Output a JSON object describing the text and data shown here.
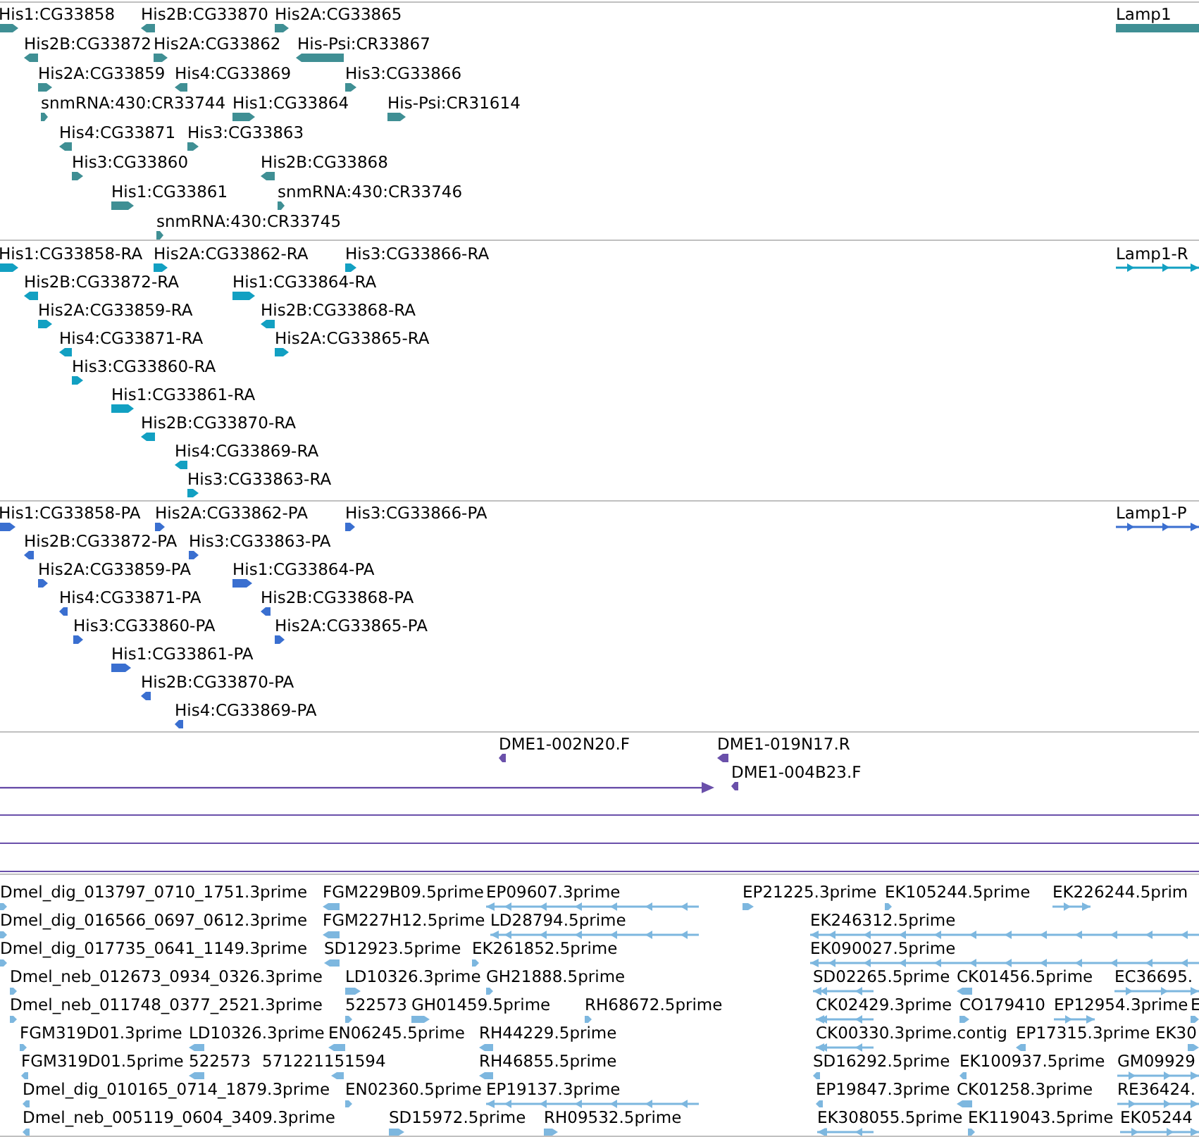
{
  "tracks": [
    {
      "kind": "gene",
      "color": "#3f8f94",
      "features": [
        {
          "label": "His1:CG33858",
          "reverse": false
        },
        {
          "label": "His2B:CG33870",
          "reverse": true
        },
        {
          "label": "His2A:CG33865",
          "reverse": false
        },
        {
          "label": "His2B:CG33872",
          "reverse": true
        },
        {
          "label": "His2A:CG33862",
          "reverse": false
        },
        {
          "label": "His-Psi:CR33867",
          "reverse": true
        },
        {
          "label": "His2A:CG33859",
          "reverse": false
        },
        {
          "label": "His4:CG33869",
          "reverse": true
        },
        {
          "label": "His3:CG33866",
          "reverse": false
        },
        {
          "label": "snmRNA:430:CR33744",
          "reverse": false
        },
        {
          "label": "His1:CG33864",
          "reverse": false
        },
        {
          "label": "His-Psi:CR31614",
          "reverse": false
        },
        {
          "label": "His4:CG33871",
          "reverse": true
        },
        {
          "label": "His3:CG33863",
          "reverse": false
        },
        {
          "label": "His3:CG33860",
          "reverse": false
        },
        {
          "label": "His2B:CG33868",
          "reverse": true
        },
        {
          "label": "His1:CG33861",
          "reverse": false
        },
        {
          "label": "snmRNA:430:CR33746",
          "reverse": false
        },
        {
          "label": "snmRNA:430:CR33745",
          "reverse": false
        },
        {
          "label": "Lamp1"
        }
      ]
    },
    {
      "kind": "transcript",
      "color": "#12a0c2",
      "features": [
        {
          "label": "His1:CG33858-RA",
          "reverse": false
        },
        {
          "label": "His2A:CG33862-RA",
          "reverse": false
        },
        {
          "label": "His3:CG33866-RA",
          "reverse": false
        },
        {
          "label": "His2B:CG33872-RA",
          "reverse": true
        },
        {
          "label": "His1:CG33864-RA",
          "reverse": false
        },
        {
          "label": "His2A:CG33859-RA",
          "reverse": false
        },
        {
          "label": "His2B:CG33868-RA",
          "reverse": true
        },
        {
          "label": "His4:CG33871-RA",
          "reverse": true
        },
        {
          "label": "His2A:CG33865-RA",
          "reverse": false
        },
        {
          "label": "His3:CG33860-RA",
          "reverse": false
        },
        {
          "label": "His1:CG33861-RA",
          "reverse": false
        },
        {
          "label": "His2B:CG33870-RA",
          "reverse": true
        },
        {
          "label": "His4:CG33869-RA",
          "reverse": true
        },
        {
          "label": "His3:CG33863-RA",
          "reverse": false
        },
        {
          "label": "Lamp1-R",
          "reverse": false
        }
      ]
    },
    {
      "kind": "protein",
      "color": "#3a6fd0",
      "features": [
        {
          "label": "His1:CG33858-PA",
          "reverse": false
        },
        {
          "label": "His2A:CG33862-PA",
          "reverse": false
        },
        {
          "label": "His3:CG33866-PA",
          "reverse": false
        },
        {
          "label": "His2B:CG33872-PA",
          "reverse": true
        },
        {
          "label": "His3:CG33863-PA",
          "reverse": false
        },
        {
          "label": "His2A:CG33859-PA",
          "reverse": false
        },
        {
          "label": "His1:CG33864-PA",
          "reverse": false
        },
        {
          "label": "His4:CG33871-PA",
          "reverse": true
        },
        {
          "label": "His2B:CG33868-PA",
          "reverse": true
        },
        {
          "label": "His3:CG33860-PA",
          "reverse": false
        },
        {
          "label": "His2A:CG33865-PA",
          "reverse": false
        },
        {
          "label": "His1:CG33861-PA",
          "reverse": false
        },
        {
          "label": "His2B:CG33870-PA",
          "reverse": true
        },
        {
          "label": "His4:CG33869-PA",
          "reverse": true
        },
        {
          "label": "Lamp1-P",
          "reverse": false
        }
      ]
    },
    {
      "kind": "clone",
      "color": "#6a50aa",
      "features": [
        {
          "label": "DME1-002N20.F",
          "reverse": true
        },
        {
          "label": "DME1-019N17.R",
          "reverse": true
        },
        {
          "label": "DME1-004B23.F",
          "reverse": true
        }
      ]
    },
    {
      "kind": "est",
      "color": "#7db7df",
      "features": [
        {
          "label": "Dmel_dig_013797_0710_1751.3prime",
          "reverse": false
        },
        {
          "label": "FGM229B09.5prime",
          "reverse": true
        },
        {
          "label": "EP09607.3prime",
          "reverse": true
        },
        {
          "label": "EP21225.3prime",
          "reverse": false
        },
        {
          "label": "EK105244.5prime",
          "reverse": false
        },
        {
          "label": "EK226244.5prim",
          "reverse": false
        },
        {
          "label": "Dmel_dig_016566_0697_0612.3prime",
          "reverse": false
        },
        {
          "label": "FGM227H12.5prime",
          "reverse": true
        },
        {
          "label": "LD28794.5prime",
          "reverse": true
        },
        {
          "label": "EK246312.5prime",
          "reverse": true
        },
        {
          "label": "Dmel_dig_017735_0641_1149.3prime",
          "reverse": false
        },
        {
          "label": "SD12923.5prime",
          "reverse": true
        },
        {
          "label": "EK261852.5prime",
          "reverse": false
        },
        {
          "label": "EK090027.5prime",
          "reverse": true
        },
        {
          "label": "Dmel_neb_012673_0934_0326.3prime",
          "reverse": false
        },
        {
          "label": "LD10326.3prime",
          "reverse": false
        },
        {
          "label": "GH21888.5prime",
          "reverse": false
        },
        {
          "label": "SD02265.5prime",
          "reverse": true
        },
        {
          "label": "CK01456.5prime",
          "reverse": true
        },
        {
          "label": "EC36695.",
          "reverse": false
        },
        {
          "label": "Dmel_neb_011748_0377_2521.3prime",
          "reverse": false
        },
        {
          "label": "522573",
          "reverse": false
        },
        {
          "label": "GH01459.5prime",
          "reverse": false
        },
        {
          "label": "RH68672.5prime",
          "reverse": false
        },
        {
          "label": "CK02429.3prime",
          "reverse": true
        },
        {
          "label": "CO179410",
          "reverse": false
        },
        {
          "label": "EP12954.3prime",
          "reverse": false
        },
        {
          "label": "E",
          "reverse": false
        },
        {
          "label": "FGM319D01.3prime",
          "reverse": false
        },
        {
          "label": "LD10326.3prime",
          "reverse": true
        },
        {
          "label": "EN06245.5prime",
          "reverse": true
        },
        {
          "label": "RH44229.5prime",
          "reverse": true
        },
        {
          "label": "CK00330.3prime.contig",
          "reverse": true
        },
        {
          "label": "EP17315.3prime",
          "reverse": true
        },
        {
          "label": "EK30",
          "reverse": false
        },
        {
          "label": "FGM319D01.5prime",
          "reverse": true
        },
        {
          "label": "522573",
          "reverse": true
        },
        {
          "label": "571221151594",
          "reverse": true
        },
        {
          "label": "RH46855.5prime",
          "reverse": true
        },
        {
          "label": "SD16292.5prime",
          "reverse": true
        },
        {
          "label": "EK100937.5prime",
          "reverse": true
        },
        {
          "label": "GM09929",
          "reverse": false
        },
        {
          "label": "Dmel_dig_010165_0714_1879.3prime",
          "reverse": true
        },
        {
          "label": "EN02360.5prime",
          "reverse": false
        },
        {
          "label": "EP19137.3prime",
          "reverse": true
        },
        {
          "label": "EP19847.3prime",
          "reverse": true
        },
        {
          "label": "CK01258.3prime",
          "reverse": true
        },
        {
          "label": "RE36424.",
          "reverse": false
        },
        {
          "label": "Dmel_neb_005119_0604_3409.3prime",
          "reverse": true
        },
        {
          "label": "SD15972.5prime",
          "reverse": false
        },
        {
          "label": "RH09532.5prime",
          "reverse": false
        },
        {
          "label": "EK308055.5prime",
          "reverse": true
        },
        {
          "label": "EK119043.5prime",
          "reverse": false
        },
        {
          "label": "EK05244",
          "reverse": false
        }
      ]
    }
  ]
}
